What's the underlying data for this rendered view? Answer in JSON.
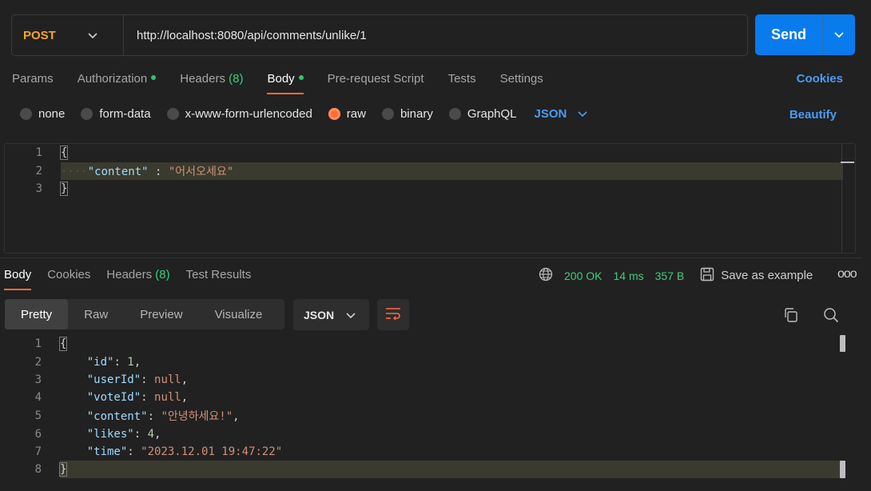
{
  "request": {
    "method": "POST",
    "url": "http://localhost:8080/api/comments/unlike/1",
    "send_label": "Send"
  },
  "request_tabs": [
    {
      "label": "Params",
      "active": false
    },
    {
      "label": "Authorization",
      "dot": true,
      "active": false
    },
    {
      "label": "Headers",
      "count": "(8)",
      "active": false
    },
    {
      "label": "Body",
      "dot": true,
      "active": true
    },
    {
      "label": "Pre-request Script",
      "active": false
    },
    {
      "label": "Tests",
      "active": false
    },
    {
      "label": "Settings",
      "active": false
    }
  ],
  "cookies_link": "Cookies",
  "body_types": [
    {
      "label": "none",
      "selected": false
    },
    {
      "label": "form-data",
      "selected": false
    },
    {
      "label": "x-www-form-urlencoded",
      "selected": false
    },
    {
      "label": "raw",
      "selected": true
    },
    {
      "label": "binary",
      "selected": false
    },
    {
      "label": "GraphQL",
      "selected": false
    }
  ],
  "body_language": "JSON",
  "beautify_label": "Beautify",
  "request_body": {
    "line_numbers": [
      "1",
      "2",
      "3"
    ],
    "open_brace": "{",
    "key": "\"content\"",
    "sep": " : ",
    "value": "\"어서오세요\"",
    "close_brace": "}"
  },
  "response_tabs": [
    {
      "label": "Body",
      "active": true
    },
    {
      "label": "Cookies",
      "active": false
    },
    {
      "label": "Headers",
      "count": "(8)",
      "active": false
    },
    {
      "label": "Test Results",
      "active": false
    }
  ],
  "response_status": {
    "status": "200 OK",
    "time": "14 ms",
    "size": "357 B",
    "save_label": "Save as example",
    "more": "ooo"
  },
  "view_modes": [
    {
      "label": "Pretty",
      "active": true
    },
    {
      "label": "Raw",
      "active": false
    },
    {
      "label": "Preview",
      "active": false
    },
    {
      "label": "Visualize",
      "active": false
    }
  ],
  "response_format": "JSON",
  "response_body": {
    "line_numbers": [
      "1",
      "2",
      "3",
      "4",
      "5",
      "6",
      "7",
      "8"
    ],
    "open_brace": "{",
    "fields": [
      {
        "key": "\"id\"",
        "value": "1",
        "type": "num",
        "comma": ","
      },
      {
        "key": "\"userId\"",
        "value": "null",
        "type": "nul",
        "comma": ","
      },
      {
        "key": "\"voteId\"",
        "value": "null",
        "type": "nul",
        "comma": ","
      },
      {
        "key": "\"content\"",
        "value": "\"안녕하세요!\"",
        "type": "str",
        "comma": ","
      },
      {
        "key": "\"likes\"",
        "value": "4",
        "type": "num",
        "comma": ","
      },
      {
        "key": "\"time\"",
        "value": "\"2023.12.01 19:47:22\"",
        "type": "str",
        "comma": ""
      }
    ],
    "close_brace": "}"
  },
  "colors": {
    "accent": "#ff6c37",
    "send": "#097bed",
    "link": "#4c9bf5",
    "success": "#3ad07d",
    "method": "#f5a623"
  }
}
